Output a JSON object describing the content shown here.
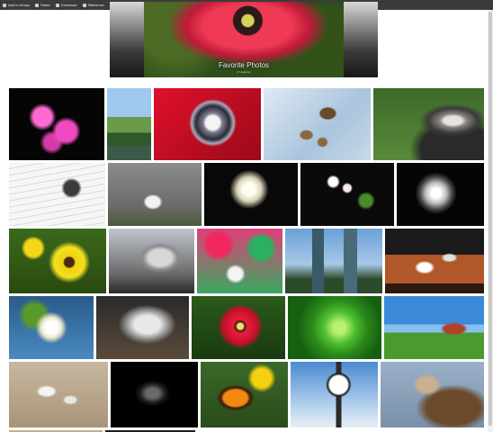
{
  "toolbar": {
    "items": [
      {
        "label": "Add to Keeps",
        "icon": "plus-icon"
      },
      {
        "label": "Share",
        "icon": "share-icon"
      },
      {
        "label": "Download",
        "icon": "download-icon"
      },
      {
        "label": "Slideshow",
        "icon": "play-icon"
      }
    ]
  },
  "hero": {
    "title": "Favorite Photos",
    "subtitle": "27 galleries"
  },
  "gallery": {
    "rows": [
      [
        {
          "name": "pink-flowers-photo"
        },
        {
          "name": "lake-photo"
        },
        {
          "name": "red-car-headlight-photo"
        },
        {
          "name": "ducks-photo"
        },
        {
          "name": "vulture-photo"
        }
      ],
      [
        {
          "name": "music-sheet-photo"
        },
        {
          "name": "heron-photo"
        },
        {
          "name": "white-flower-photo"
        },
        {
          "name": "white-blossom-photo"
        },
        {
          "name": "black-white-flower-photo"
        }
      ],
      [
        {
          "name": "yellow-flower-bee-photo"
        },
        {
          "name": "capitol-building-photo"
        },
        {
          "name": "fan-dancer-photo"
        },
        {
          "name": "twin-towers-photo"
        },
        {
          "name": "table-setting-photo"
        }
      ],
      [
        {
          "name": "white-bloom-photo"
        },
        {
          "name": "sculpture-photo"
        },
        {
          "name": "red-poppy-photo"
        },
        {
          "name": "green-leaves-photo"
        },
        {
          "name": "resort-golf-photo"
        }
      ],
      [
        {
          "name": "seagull-beach-photo"
        },
        {
          "name": "silhouette-photo"
        },
        {
          "name": "butterfly-flower-photo"
        },
        {
          "name": "street-clock-photo"
        },
        {
          "name": "hawk-photo"
        }
      ]
    ]
  }
}
